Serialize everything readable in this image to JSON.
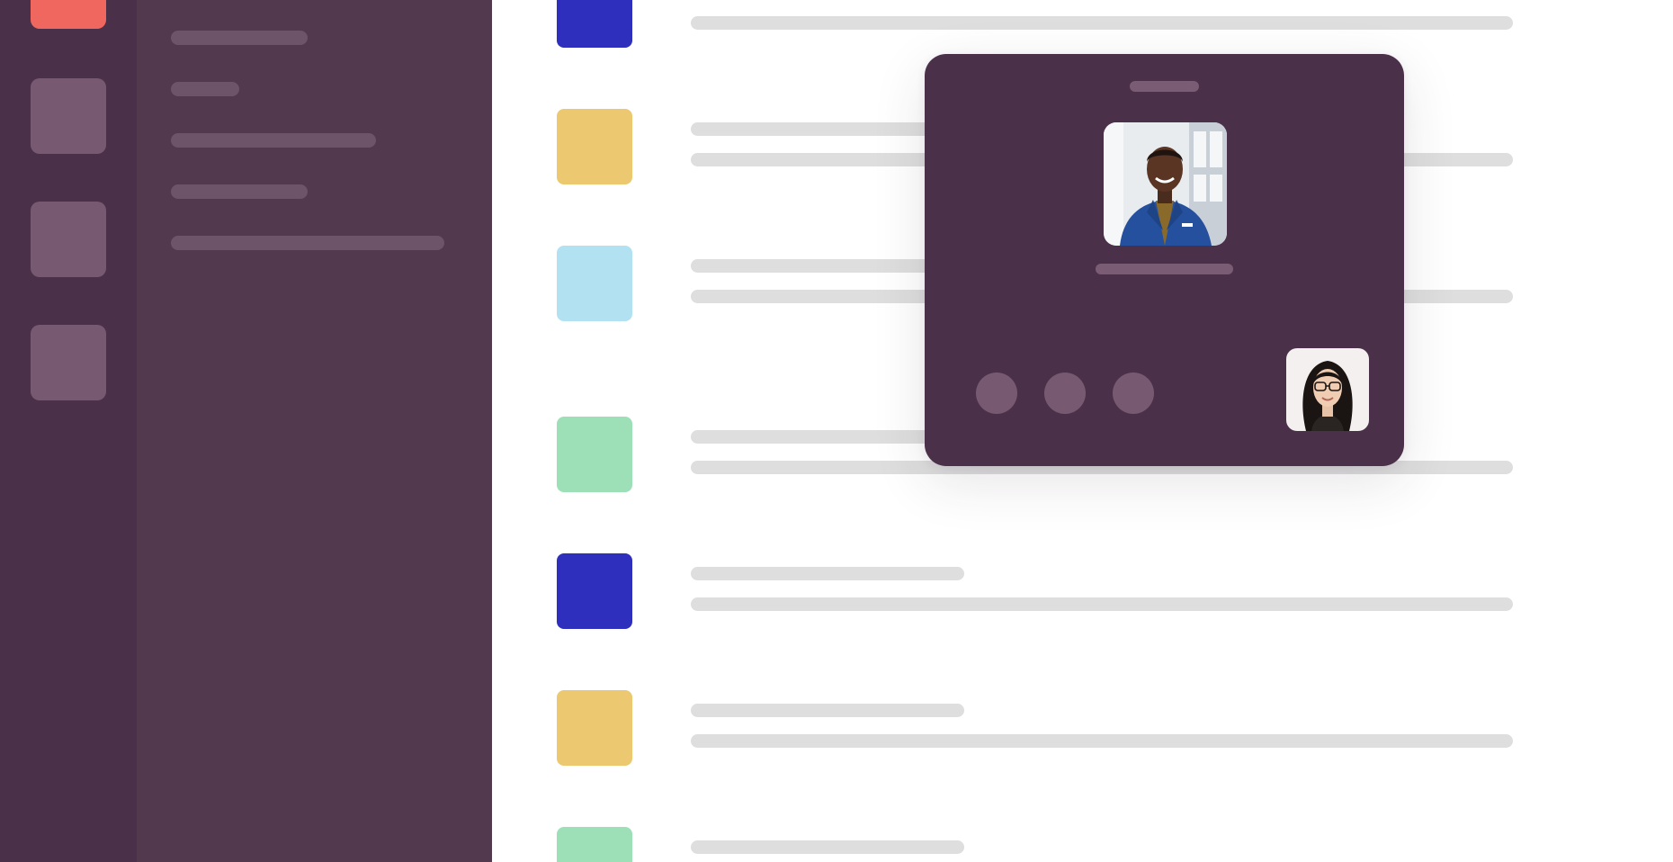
{
  "colors": {
    "rail_bg": "#4a3149",
    "sidebar_bg": "#52394e",
    "active_workspace": "#f0675f",
    "workspace_tile": "#775a72",
    "huddle_bg": "#4a3049",
    "placeholder_line": "#dedede"
  },
  "messages": [
    {
      "avatar_color": "#2f2fbd"
    },
    {
      "avatar_color": "#ecc870"
    },
    {
      "avatar_color": "#b2e1f2"
    },
    {
      "avatar_color": "#9de0b8"
    },
    {
      "avatar_color": "#2f2fbd"
    },
    {
      "avatar_color": "#ecc870"
    },
    {
      "avatar_color": "#9de0b8"
    }
  ],
  "huddle": {
    "controls": [
      "mute-icon",
      "video-icon",
      "leave-icon"
    ]
  }
}
